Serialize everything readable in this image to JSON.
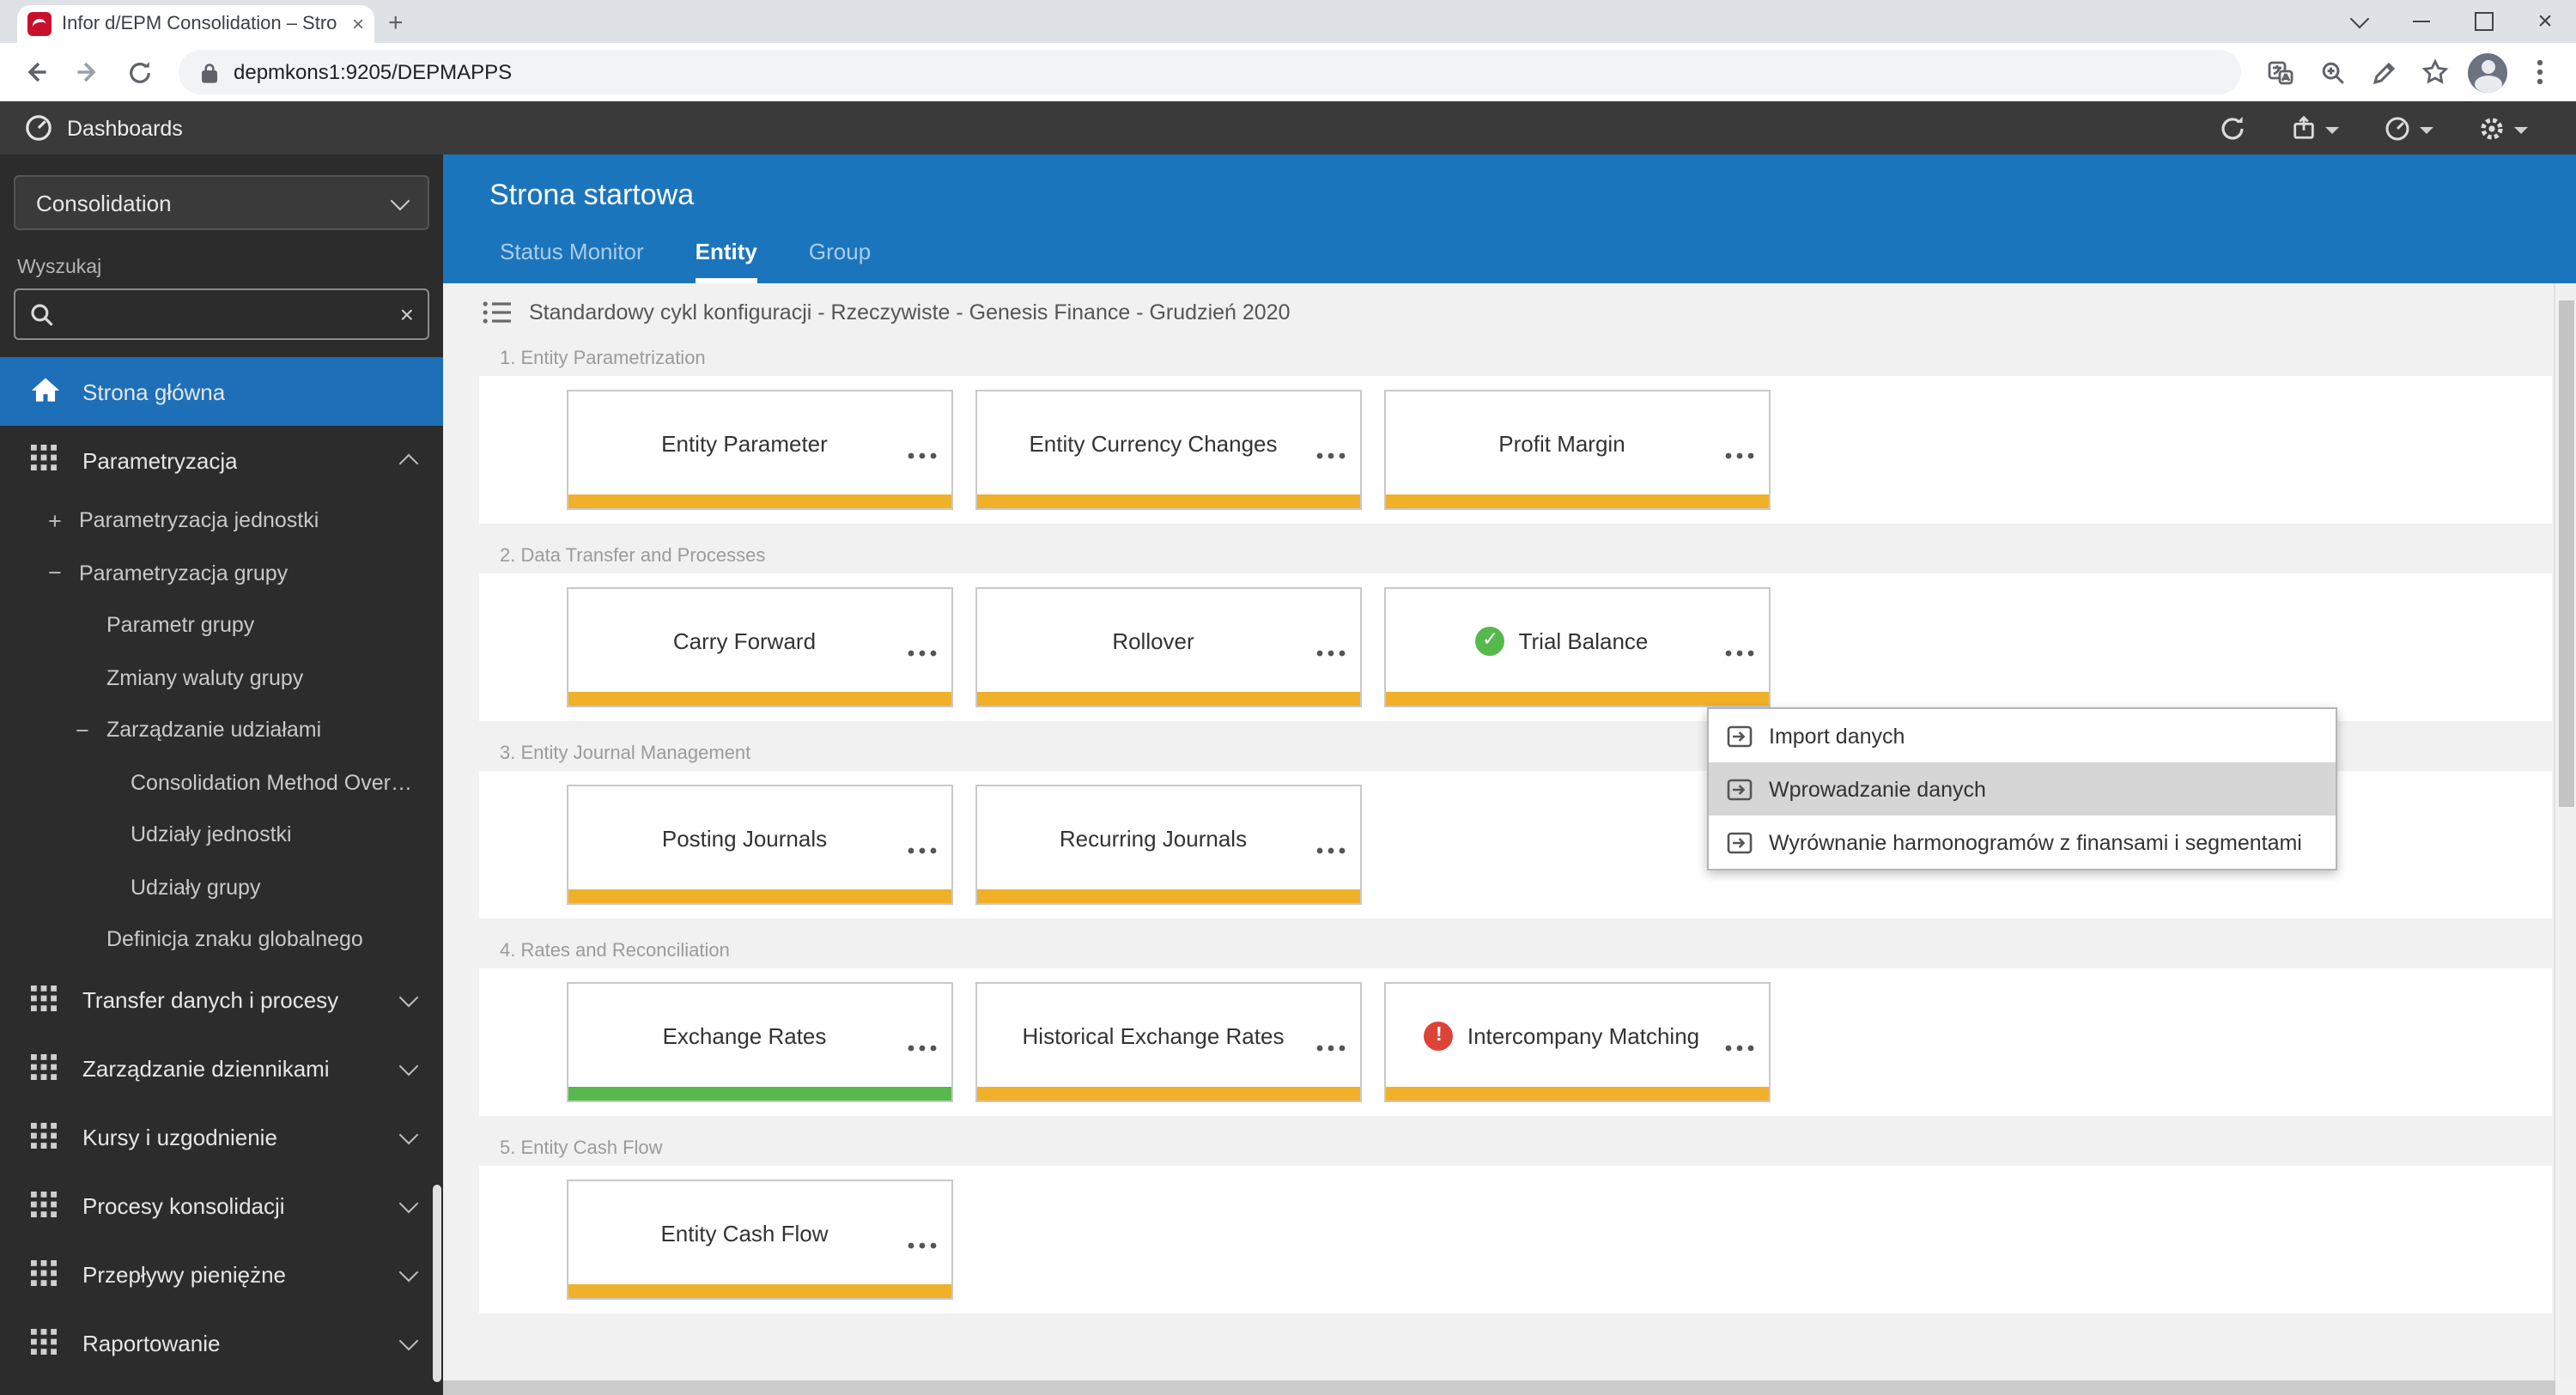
{
  "colors": {
    "blue": "#1B75BC",
    "yellow": "#F0B02A",
    "green": "#56B94B",
    "red": "#DB4437",
    "selected": "#1D6FB8"
  },
  "browser": {
    "tab_title": "Infor d/EPM Consolidation – Stro",
    "url": "depmkons1:9205/DEPMAPPS"
  },
  "app_header": {
    "title": "Dashboards"
  },
  "sidebar": {
    "module_selector": "Consolidation",
    "search_label": "Wyszukaj",
    "items": [
      {
        "label": "Strona główna",
        "cls": "top sel",
        "icon": "home",
        "chevron": "",
        "prefix": ""
      },
      {
        "label": "Parametryzacja",
        "cls": "top",
        "icon": "grid",
        "chevron": "up",
        "prefix": ""
      },
      {
        "label": "Parametryzacja jednostki",
        "cls": "sub1",
        "icon": "",
        "chevron": "",
        "prefix": "+"
      },
      {
        "label": "Parametryzacja grupy",
        "cls": "sub1",
        "icon": "",
        "chevron": "",
        "prefix": "−"
      },
      {
        "label": "Parametr grupy",
        "cls": "sub2",
        "icon": "",
        "chevron": "",
        "prefix": ""
      },
      {
        "label": "Zmiany waluty grupy",
        "cls": "sub2",
        "icon": "",
        "chevron": "",
        "prefix": ""
      },
      {
        "label": "Zarządzanie udziałami",
        "cls": "sub2",
        "icon": "",
        "chevron": "",
        "prefix": "−"
      },
      {
        "label": "Consolidation Method Overv...",
        "cls": "sub3",
        "icon": "",
        "chevron": "",
        "prefix": ""
      },
      {
        "label": "Udziały jednostki",
        "cls": "sub3",
        "icon": "",
        "chevron": "",
        "prefix": ""
      },
      {
        "label": "Udziały grupy",
        "cls": "sub3",
        "icon": "",
        "chevron": "",
        "prefix": ""
      },
      {
        "label": "Definicja znaku globalnego",
        "cls": "sub2",
        "icon": "",
        "chevron": "",
        "prefix": ""
      },
      {
        "label": "Transfer danych i procesy",
        "cls": "top",
        "icon": "grid",
        "chevron": "down",
        "prefix": ""
      },
      {
        "label": "Zarządzanie dziennikami",
        "cls": "top",
        "icon": "grid",
        "chevron": "down",
        "prefix": ""
      },
      {
        "label": "Kursy i uzgodnienie",
        "cls": "top",
        "icon": "grid",
        "chevron": "down",
        "prefix": ""
      },
      {
        "label": "Procesy konsolidacji",
        "cls": "top",
        "icon": "grid",
        "chevron": "down",
        "prefix": ""
      },
      {
        "label": "Przepływy pieniężne",
        "cls": "top",
        "icon": "grid",
        "chevron": "down",
        "prefix": ""
      },
      {
        "label": "Raportowanie",
        "cls": "top",
        "icon": "grid",
        "chevron": "down",
        "prefix": ""
      }
    ]
  },
  "main": {
    "page_title": "Strona startowa",
    "tabs": [
      {
        "label": "Status Monitor",
        "cls": ""
      },
      {
        "label": "Entity",
        "cls": "active"
      },
      {
        "label": "Group",
        "cls": ""
      }
    ],
    "config_bar": "Standardowy cykl konfiguracji - Rzeczywiste - Genesis Finance - Grudzień 2020",
    "sections": [
      {
        "label": "1. Entity Parametrization",
        "cards": [
          {
            "title": "Entity Parameter",
            "bar": "yellow",
            "status": ""
          },
          {
            "title": "Entity Currency Changes",
            "bar": "yellow",
            "status": ""
          },
          {
            "title": "Profit Margin",
            "bar": "yellow",
            "status": ""
          }
        ]
      },
      {
        "label": "2. Data Transfer and Processes",
        "cards": [
          {
            "title": "Carry Forward",
            "bar": "yellow",
            "status": ""
          },
          {
            "title": "Rollover",
            "bar": "yellow",
            "status": ""
          },
          {
            "title": "Trial Balance",
            "bar": "yellow",
            "status": "ok"
          }
        ]
      },
      {
        "label": "3. Entity Journal Management",
        "cards": [
          {
            "title": "Posting Journals",
            "bar": "yellow",
            "status": ""
          },
          {
            "title": "Recurring Journals",
            "bar": "yellow",
            "status": ""
          }
        ]
      },
      {
        "label": "4. Rates and Reconciliation",
        "cards": [
          {
            "title": "Exchange Rates",
            "bar": "green",
            "status": ""
          },
          {
            "title": "Historical Exchange Rates",
            "bar": "yellow",
            "status": ""
          },
          {
            "title": "Intercompany Matching",
            "bar": "yellow",
            "status": "error"
          }
        ]
      },
      {
        "label": "5. Entity Cash Flow",
        "cards": [
          {
            "title": "Entity Cash Flow",
            "bar": "yellow",
            "status": ""
          }
        ]
      }
    ],
    "context_menu": {
      "items": [
        {
          "label": "Import danych",
          "cls": ""
        },
        {
          "label": "Wprowadzanie danych",
          "cls": "hl"
        },
        {
          "label": "Wyrównanie harmonogramów z finansami i segmentami",
          "cls": ""
        }
      ]
    }
  }
}
